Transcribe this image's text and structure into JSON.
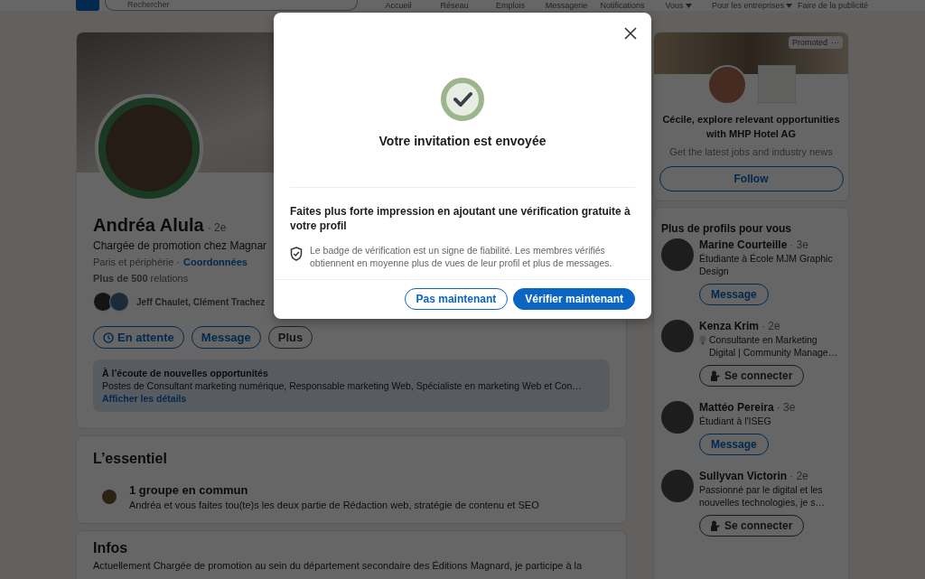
{
  "nav": {
    "search": {
      "placeholder": "Rechercher"
    },
    "items": [
      {
        "label": "Accueil",
        "dropdown": false
      },
      {
        "label": "Réseau",
        "dropdown": false
      },
      {
        "label": "Emplois",
        "dropdown": false
      },
      {
        "label": "Messagerie",
        "dropdown": false
      },
      {
        "label": "Notifications",
        "dropdown": false
      },
      {
        "label": "Vous",
        "dropdown": true
      }
    ],
    "extra": [
      {
        "label": "Pour les entreprises",
        "dropdown": true
      },
      {
        "label": "Faire de la publicité",
        "dropdown": false
      }
    ]
  },
  "profile": {
    "name": "Andréa Alula",
    "degree": "· 2e",
    "headline": "Chargée de promotion chez Magnar",
    "location": "Paris et périphérie ·",
    "contact": "Coordonnées",
    "connections": "**Plus de 500** relations",
    "mutual": "Jeff Chaulet, Clément Trachez",
    "actions": [
      {
        "kind": "pending",
        "label": "En attente"
      },
      {
        "kind": "outline",
        "label": "Message"
      },
      {
        "kind": "neutral",
        "label": "Plus"
      }
    ],
    "open_to_work": {
      "title": "À l’écoute de nouvelles opportunités",
      "text": "Postes de Consultant marketing numérique, Responsable marketing Web, Spécialiste en marketing Web et Con…",
      "link": "Afficher les détails"
    }
  },
  "essentials": {
    "title": "L’essentiel",
    "item_title": "1 groupe en commun",
    "item_text": "Andréa et vous faites tou(te)s les deux partie de Rédaction web, stratégie de contenu et SEO"
  },
  "about": {
    "title": "Infos",
    "text": "Actuellement Chargée de promotion au sein du département secondaire des Éditions Magnard, je participe à la"
  },
  "ad": {
    "badge": "Promoted",
    "menu": "···",
    "headline": "Cécile, explore relevant opportunities with MHP Hotel AG",
    "subtext": "Get the latest jobs and industry news",
    "button": "Follow"
  },
  "suggestions": {
    "title": "Plus de profils pour vous",
    "people": [
      {
        "name": "Marine Courteille",
        "degree": "· 3e",
        "bulb": false,
        "headline": "Étudiante à École MJM Graphic Design",
        "action": {
          "kind": "message",
          "label": "Message"
        }
      },
      {
        "name": "Kenza Krim",
        "degree": "· 2e",
        "bulb": true,
        "headline": "Consultante en Marketing Digital | Community Manage…",
        "action": {
          "kind": "connect",
          "label": "Se connecter"
        }
      },
      {
        "name": "Mattéo Pereira",
        "degree": "· 3e",
        "bulb": false,
        "headline": "Étudiant à l'ISEG",
        "action": {
          "kind": "message",
          "label": "Message"
        }
      },
      {
        "name": "Sullyvan Victorin",
        "degree": "· 2e",
        "bulb": false,
        "headline": "Passionné par le digital et les nouvelles technologies, je s…",
        "action": {
          "kind": "connect",
          "label": "Se connecter"
        }
      }
    ]
  },
  "modal": {
    "title": "Votre invitation est envoyée",
    "heading": "Faites plus forte impression en ajoutant une vérification gratuite à votre profil",
    "body": "Le badge de vérification est un signe de fiabilité. Les membres vérifiés obtiennent en moyenne plus de vues de leur profil et plus de messages.",
    "buttons": [
      {
        "kind": "secondary",
        "label": "Pas maintenant"
      },
      {
        "kind": "primary",
        "label": "Vérifier maintenant"
      }
    ]
  }
}
